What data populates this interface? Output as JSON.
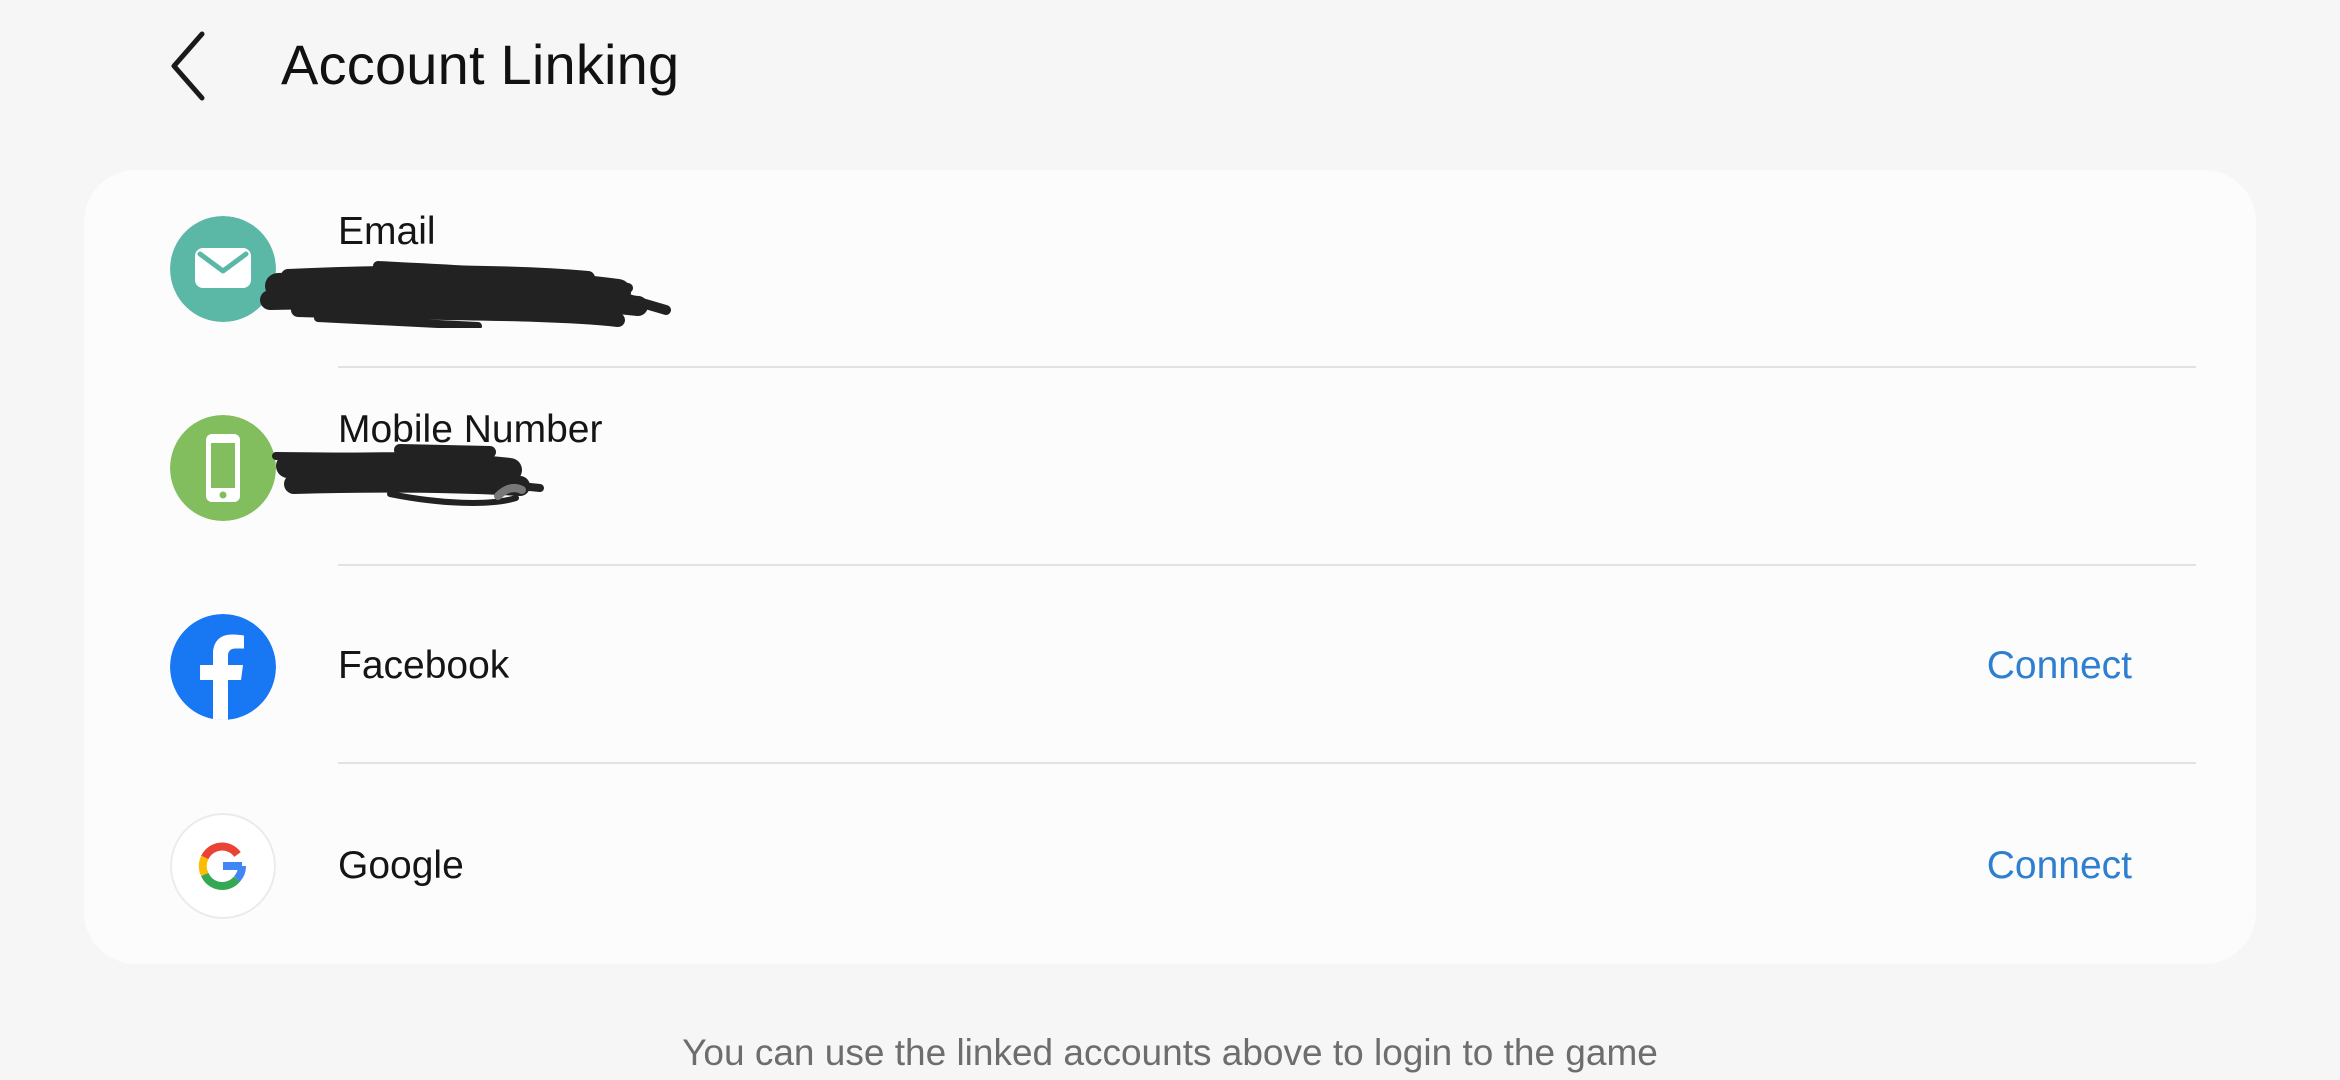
{
  "header": {
    "back_icon": "chevron-left-icon",
    "title": "Account Linking"
  },
  "accounts": [
    {
      "label": "Email",
      "icon": "envelope-icon",
      "icon_color": "#5bb8a6",
      "value_redacted": true
    },
    {
      "label": "Mobile Number",
      "icon": "smartphone-icon",
      "icon_color": "#82bd5e",
      "value_redacted": true
    },
    {
      "label": "Facebook",
      "icon": "facebook-icon",
      "icon_color": "#1877f2",
      "action_label": "Connect"
    },
    {
      "label": "Google",
      "icon": "google-icon",
      "icon_color": "#ffffff",
      "action_label": "Connect"
    }
  ],
  "footer": {
    "note": "You can use the linked accounts above to login to the game"
  },
  "colors": {
    "background": "#f6f6f6",
    "card": "#fcfcfc",
    "link": "#2f7fd0",
    "divider": "#e2e2e2"
  }
}
